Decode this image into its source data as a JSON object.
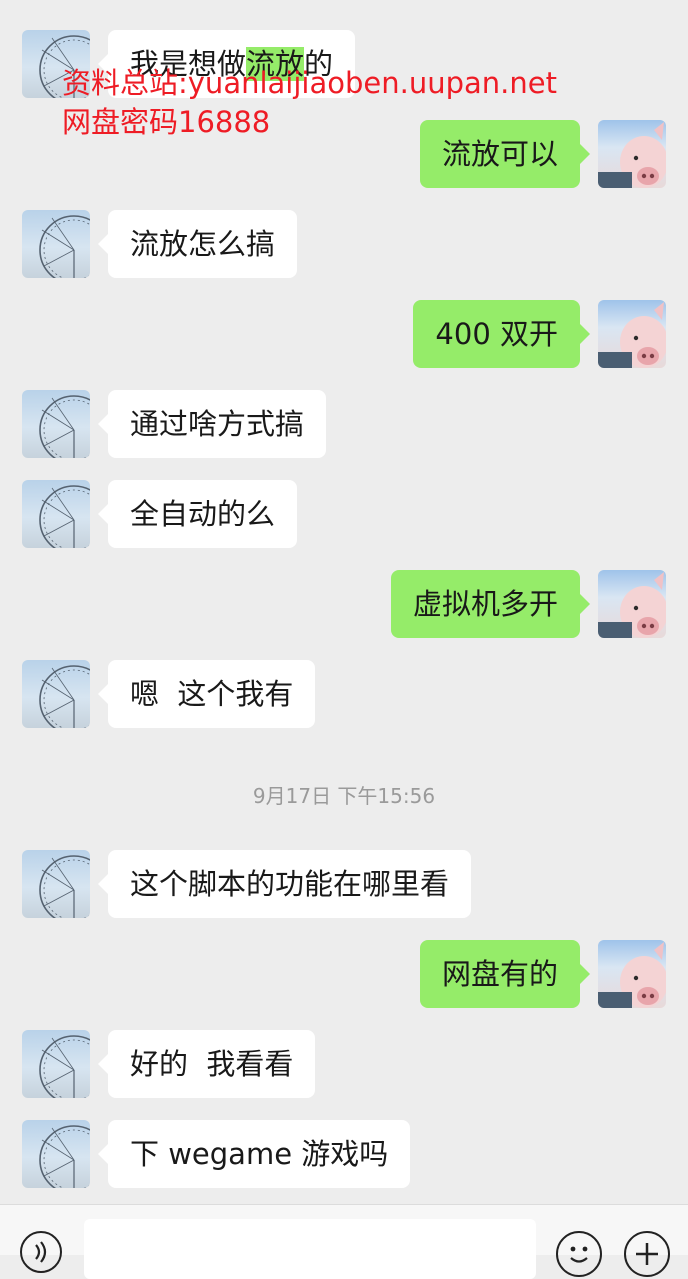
{
  "watermark": {
    "line1": "资料总站:yuanlaijiaoben.uupan.net",
    "line2": "网盘密码16888"
  },
  "messages": [
    {
      "side": "left",
      "text_before": "我是想做",
      "text_highlight": "流放",
      "text_after": "的"
    },
    {
      "side": "right",
      "text": "流放可以"
    },
    {
      "side": "left",
      "text": "流放怎么搞"
    },
    {
      "side": "right",
      "text": "400 双开"
    },
    {
      "side": "left",
      "text": "通过啥方式搞"
    },
    {
      "side": "left",
      "text": "全自动的么"
    },
    {
      "side": "right",
      "text": "虚拟机多开"
    },
    {
      "side": "left",
      "text": "嗯  这个我有"
    },
    {
      "side": "left",
      "text": "这个脚本的功能在哪里看"
    },
    {
      "side": "right",
      "text": "网盘有的"
    },
    {
      "side": "left",
      "text": "好的  我看看"
    },
    {
      "side": "left",
      "text": "下 wegame 游戏吗"
    }
  ],
  "timestamp": "9月17日 下午15:56",
  "avatars": {
    "left": "ferris-wheel-avatar",
    "right": "pig-avatar"
  },
  "input_bar": {
    "icons": [
      "voice-icon",
      "emoji-icon",
      "plus-icon"
    ]
  },
  "colors": {
    "background": "#ededed",
    "bubble_self": "#95ec69",
    "bubble_other": "#ffffff",
    "watermark": "#ee1c25",
    "timestamp": "#9a9a9a"
  }
}
